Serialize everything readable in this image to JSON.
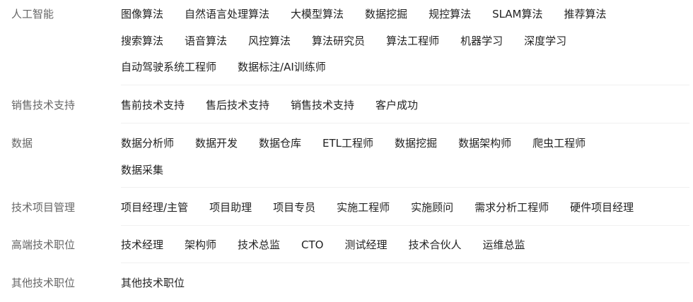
{
  "categories": [
    {
      "title": "人工智能",
      "lines": [
        [
          "图像算法",
          "自然语言处理算法",
          "大模型算法",
          "数据挖掘",
          "规控算法",
          "SLAM算法",
          "推荐算法"
        ],
        [
          "搜索算法",
          "语音算法",
          "风控算法",
          "算法研究员",
          "算法工程师",
          "机器学习",
          "深度学习"
        ],
        [
          "自动驾驶系统工程师",
          "数据标注/AI训练师"
        ]
      ]
    },
    {
      "title": "销售技术支持",
      "lines": [
        [
          "售前技术支持",
          "售后技术支持",
          "销售技术支持",
          "客户成功"
        ]
      ]
    },
    {
      "title": "数据",
      "lines": [
        [
          "数据分析师",
          "数据开发",
          "数据仓库",
          "ETL工程师",
          "数据挖掘",
          "数据架构师",
          "爬虫工程师"
        ],
        [
          "数据采集"
        ]
      ]
    },
    {
      "title": "技术项目管理",
      "lines": [
        [
          "项目经理/主管",
          "项目助理",
          "项目专员",
          "实施工程师",
          "实施顾问",
          "需求分析工程师",
          "硬件项目经理"
        ]
      ]
    },
    {
      "title": "高端技术职位",
      "lines": [
        [
          "技术经理",
          "架构师",
          "技术总监",
          "CTO",
          "测试经理",
          "技术合伙人",
          "运维总监"
        ]
      ]
    },
    {
      "title": "其他技术职位",
      "lines": [
        [
          "其他技术职位"
        ]
      ]
    }
  ]
}
